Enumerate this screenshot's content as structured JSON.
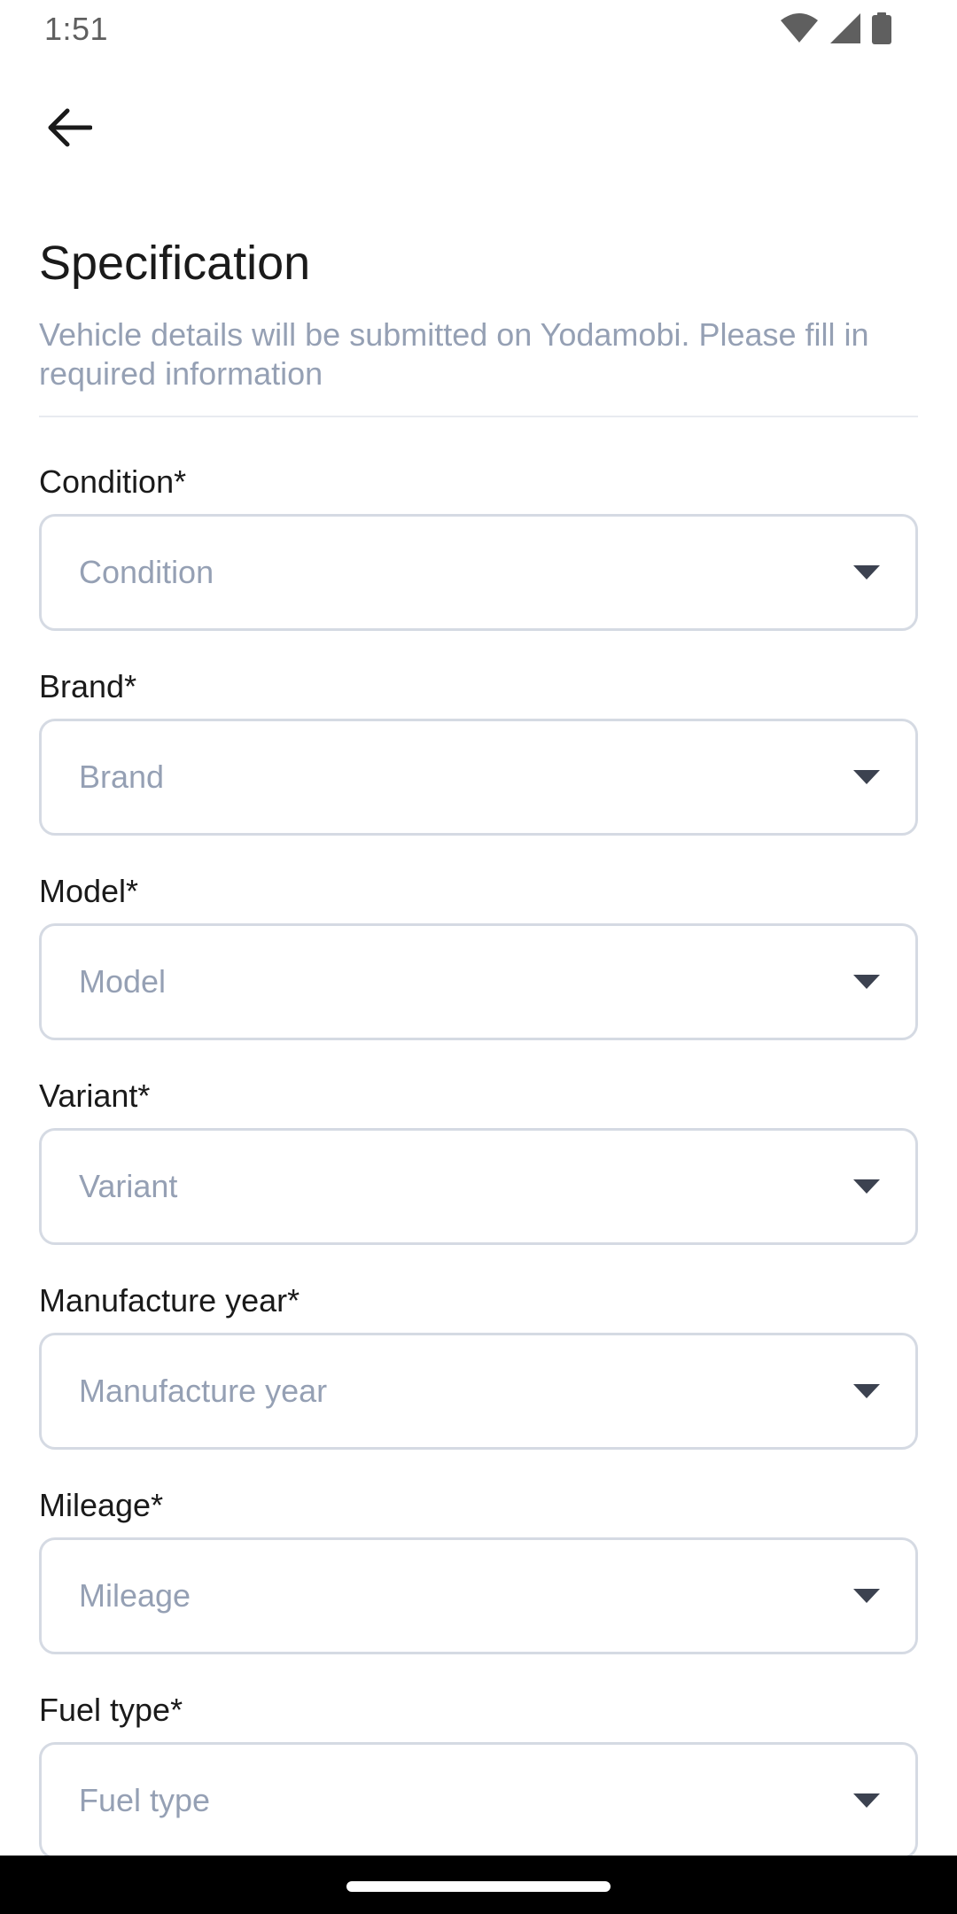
{
  "status_bar": {
    "time": "1:51",
    "icons": [
      "wifi-icon",
      "signal-icon",
      "battery-icon"
    ]
  },
  "header": {
    "back_icon": "arrow-left-icon",
    "title": "Specification",
    "subtitle": "Vehicle details will be submitted on Yodamobi. Please fill in required information"
  },
  "form": {
    "fields": [
      {
        "label": "Condition*",
        "placeholder": "Condition"
      },
      {
        "label": "Brand*",
        "placeholder": "Brand"
      },
      {
        "label": "Model*",
        "placeholder": "Model"
      },
      {
        "label": "Variant*",
        "placeholder": "Variant"
      },
      {
        "label": "Manufacture year*",
        "placeholder": "Manufacture year"
      },
      {
        "label": "Mileage*",
        "placeholder": "Mileage"
      },
      {
        "label": "Fuel type*",
        "placeholder": "Fuel type"
      }
    ]
  },
  "colors": {
    "title_text": "#1a1a1a",
    "placeholder_text": "#95a0b4",
    "field_border": "#d5dae3",
    "divider": "#e8ebf0",
    "caret": "#3c4250",
    "nav_bar": "#000000"
  }
}
